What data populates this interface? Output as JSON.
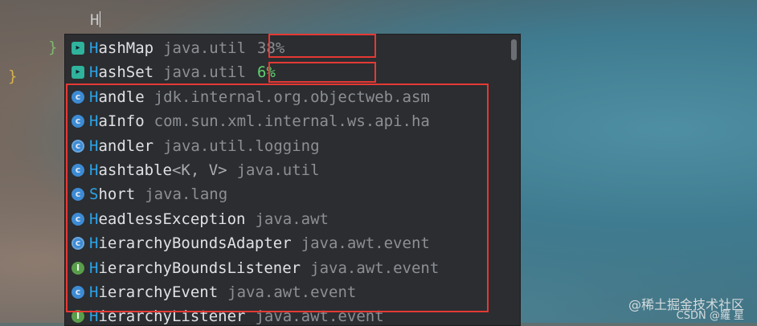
{
  "editor": {
    "typed_text": "H",
    "close_brace_green": "}",
    "close_brace_yellow": "}"
  },
  "completion": {
    "items": [
      {
        "icon": "template-icon",
        "kind": "tpl",
        "match": "H",
        "rest": "ashMap",
        "generic": "",
        "pkg": "java.util",
        "pct": "38%",
        "pct_color": "gray"
      },
      {
        "icon": "template-icon",
        "kind": "tpl",
        "match": "H",
        "rest": "ashSet",
        "generic": "",
        "pkg": "java.util",
        "pct": "6%",
        "pct_color": "green"
      },
      {
        "icon": "class-icon",
        "kind": "cls",
        "match": "H",
        "rest": "andle",
        "generic": "",
        "pkg": "jdk.internal.org.objectweb.asm"
      },
      {
        "icon": "class-icon",
        "kind": "cls",
        "match": "H",
        "rest": "aInfo",
        "generic": "",
        "pkg": "com.sun.xml.internal.ws.api.ha"
      },
      {
        "icon": "abstract-class-icon",
        "kind": "abs",
        "match": "H",
        "rest": "andler",
        "generic": "",
        "pkg": "java.util.logging"
      },
      {
        "icon": "class-icon",
        "kind": "cls",
        "match": "H",
        "rest": "ashtable",
        "generic": "<K, V>",
        "pkg": "java.util"
      },
      {
        "icon": "class-icon",
        "kind": "cls",
        "match": "",
        "rest": "Short",
        "generic": "",
        "pkg": "java.lang",
        "match_in": "S",
        "short": true
      },
      {
        "icon": "class-icon",
        "kind": "cls",
        "match": "H",
        "rest": "eadlessException",
        "generic": "",
        "pkg": "java.awt"
      },
      {
        "icon": "abstract-class-icon",
        "kind": "abs",
        "match": "H",
        "rest": "ierarchyBoundsAdapter",
        "generic": "",
        "pkg": "java.awt.event"
      },
      {
        "icon": "interface-icon",
        "kind": "itf",
        "match": "H",
        "rest": "ierarchyBoundsListener",
        "generic": "",
        "pkg": "java.awt.event"
      },
      {
        "icon": "class-icon",
        "kind": "cls",
        "match": "H",
        "rest": "ierarchyEvent",
        "generic": "",
        "pkg": "java.awt.event"
      },
      {
        "icon": "interface-icon",
        "kind": "itf",
        "match": "H",
        "rest": "ierarchyListener",
        "generic": "",
        "pkg": "java.awt.event"
      }
    ]
  },
  "watermark": {
    "line1": "@稀土掘金技术社区",
    "line2": "CSDN @羅 星"
  },
  "colors": {
    "annotation": "#e53935",
    "match_highlight": "#2ba3e8",
    "popup_bg": "#2b2d30",
    "pct_green": "#5fd06f"
  }
}
